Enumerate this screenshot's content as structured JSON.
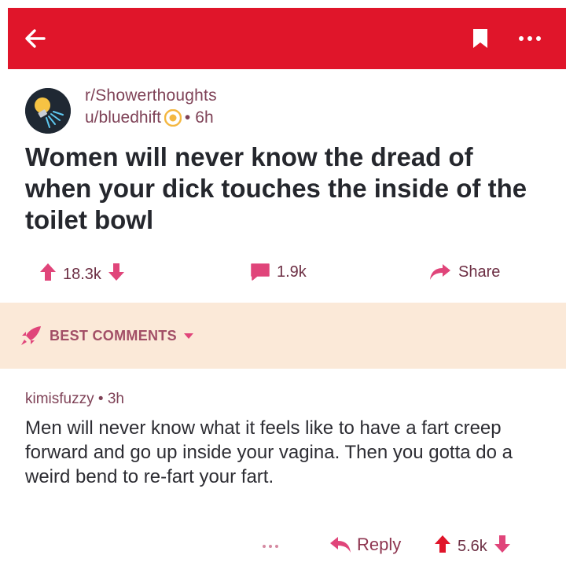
{
  "colors": {
    "header_bar": "#e0152a",
    "accent_pink": "#e0457a",
    "best_bar_bg": "#fbe9d8",
    "meta_text": "#7f4257"
  },
  "header": {
    "back_icon": "arrow-left-icon",
    "bookmark_icon": "bookmark-icon",
    "more_icon": "more-dots-icon"
  },
  "post": {
    "subreddit": "r/Showerthoughts",
    "author": "u/bluedhift",
    "separator": "•",
    "age": "6h",
    "title": "Women will never know the dread of when your dick touches the inside of the toilet bowl",
    "upvotes": "18.3k",
    "comments": "1.9k",
    "share_label": "Share"
  },
  "comments_section": {
    "sort_label": "BEST COMMENTS"
  },
  "comment": {
    "author": "kimisfuzzy",
    "separator": "•",
    "age": "3h",
    "body": "Men will never know what it feels like to have a fart creep forward and go up inside your vagina. Then you gotta do a weird bend to re-fart your fart.",
    "more_label": "...",
    "reply_label": "Reply",
    "upvotes": "5.6k"
  }
}
